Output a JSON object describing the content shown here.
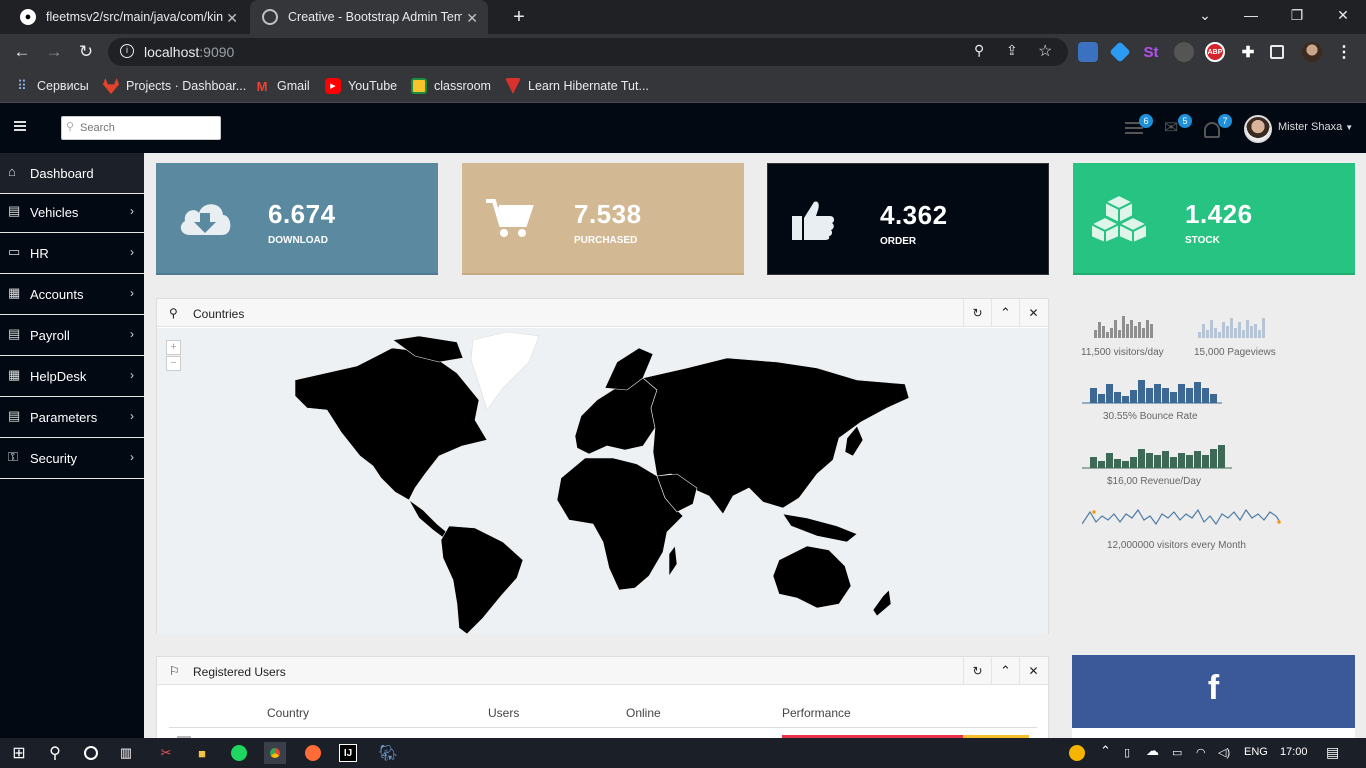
{
  "browser": {
    "tabs": [
      {
        "title": "fleetmsv2/src/main/java/com/kin",
        "icon": "github-icon"
      },
      {
        "title": "Creative - Bootstrap Admin Temp",
        "icon": "globe-icon"
      }
    ],
    "url_host": "localhost",
    "url_port": ":9090",
    "bookmarks": [
      {
        "label": "Сервисы",
        "icon": "apps-grid-icon"
      },
      {
        "label": "Projects · Dashboar...",
        "icon": "gitlab-icon"
      },
      {
        "label": "Gmail",
        "icon": "gmail-icon"
      },
      {
        "label": "YouTube",
        "icon": "youtube-icon"
      },
      {
        "label": "classroom",
        "icon": "classroom-icon"
      },
      {
        "label": "Learn Hibernate Tut...",
        "icon": "hibernate-icon"
      }
    ]
  },
  "header": {
    "search_placeholder": "Search",
    "badges": {
      "tasks": "6",
      "mail": "5",
      "notifications": "7"
    },
    "user_name": "Mister Shaxa"
  },
  "sidebar": {
    "items": [
      {
        "label": "Dashboard",
        "icon": "home-icon"
      },
      {
        "label": "Vehicles",
        "icon": "document-icon"
      },
      {
        "label": "HR",
        "icon": "monitor-icon"
      },
      {
        "label": "Accounts",
        "icon": "table-icon"
      },
      {
        "label": "Payroll",
        "icon": "document-icon"
      },
      {
        "label": "HelpDesk",
        "icon": "table-icon"
      },
      {
        "label": "Parameters",
        "icon": "document-icon"
      },
      {
        "label": "Security",
        "icon": "key-icon"
      }
    ]
  },
  "stats": [
    {
      "value": "6.674",
      "label": "DOWNLOAD",
      "color": "#5b8aa0",
      "icon": "cloud-download-icon"
    },
    {
      "value": "7.538",
      "label": "PURCHASED",
      "color": "#d3b993",
      "icon": "shopping-cart-icon"
    },
    {
      "value": "4.362",
      "label": "ORDER",
      "color": "#020913",
      "icon": "thumbs-up-icon"
    },
    {
      "value": "1.426",
      "label": "STOCK",
      "color": "#27c383",
      "icon": "cubes-icon"
    }
  ],
  "map_panel": {
    "title": "Countries",
    "zoom_in": "+",
    "zoom_out": "−"
  },
  "mini_stats": [
    {
      "label": "11,500 visitors/day",
      "color": "#8f8f8f"
    },
    {
      "label": "15,000 Pageviews",
      "color": "#b7c4d6"
    },
    {
      "label": "30.55% Bounce Rate",
      "color": "#3e6894"
    },
    {
      "label": "$16,00 Revenue/Day",
      "color": "#3e6956"
    },
    {
      "label": "12,000000 visitors every Month",
      "color": "#4f7ca8"
    }
  ],
  "users_panel": {
    "title": "Registered Users",
    "columns": [
      "Country",
      "Users",
      "Online",
      "Performance"
    ]
  },
  "facebook": {
    "glyph": "f"
  },
  "taskbar": {
    "lang": "ENG",
    "time": "17:00"
  }
}
